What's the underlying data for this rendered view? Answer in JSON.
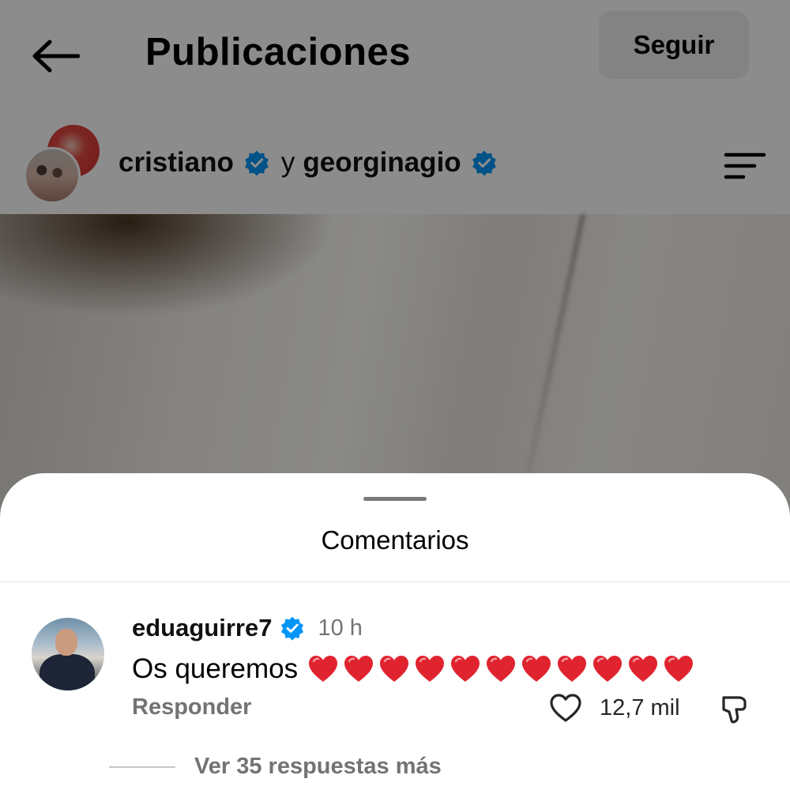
{
  "header": {
    "title": "Publicaciones",
    "follow_label": "Seguir"
  },
  "post": {
    "author_1": "cristiano",
    "joiner": "y",
    "author_2": "georginagio"
  },
  "sheet": {
    "title": "Comentarios"
  },
  "comment": {
    "username": "eduaguirre7",
    "time": "10 h",
    "text": "Os queremos",
    "heart_count": 11,
    "reply_label": "Responder",
    "likes": "12,7 mil",
    "view_replies": "Ver 35 respuestas más"
  },
  "colors": {
    "verified_blue": "#0095f6",
    "heart_red": "#e0242f",
    "overlay": "rgba(0,0,0,0.45)",
    "muted_text": "#737373"
  },
  "icons": {
    "back": "arrow-left-icon",
    "verified": "verified-badge-icon",
    "menu": "menu-lines-icon",
    "like": "heart-outline-icon",
    "dislike": "thumbs-down-icon",
    "heart_emoji": "red-heart-emoji"
  }
}
